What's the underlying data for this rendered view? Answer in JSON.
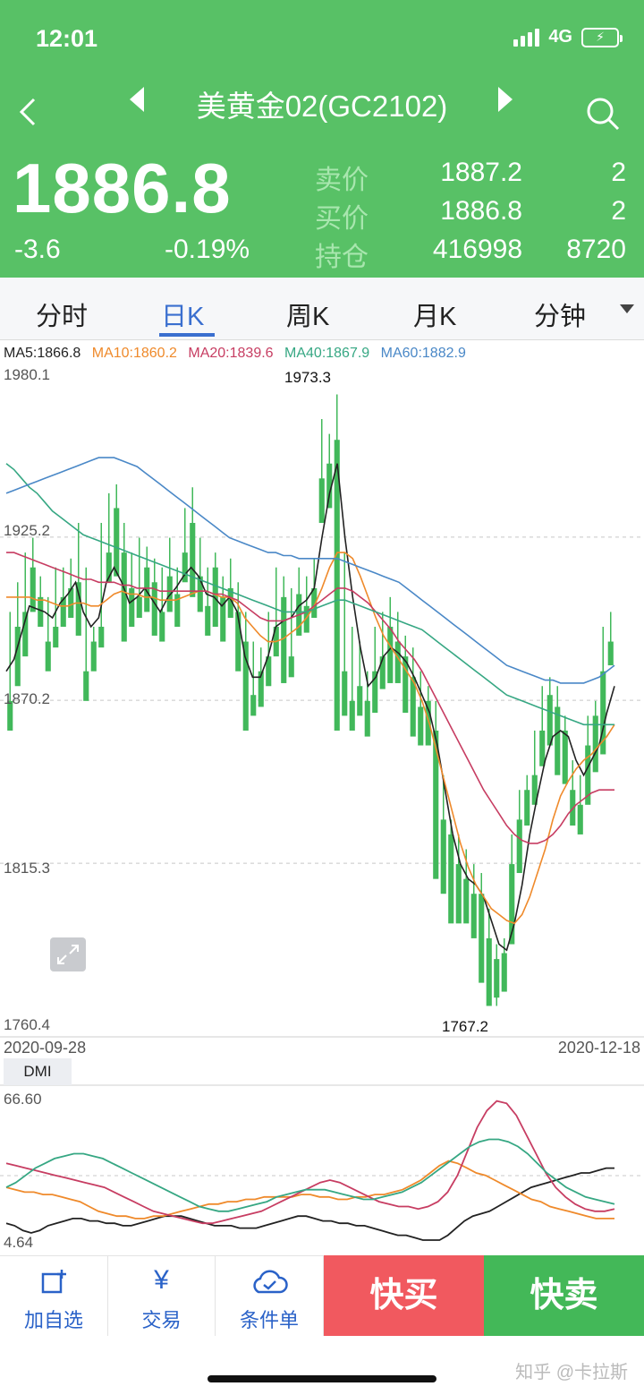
{
  "status": {
    "time": "12:01",
    "network": "4G"
  },
  "header": {
    "title": "美黄金02(GC2102)"
  },
  "quote": {
    "last": "1886.8",
    "change": "-3.6",
    "change_pct": "-0.19%",
    "ask_label": "卖价",
    "ask": "1887.2",
    "ask_vol": "2",
    "bid_label": "买价",
    "bid": "1886.8",
    "bid_vol": "2",
    "oi_label": "持仓",
    "oi": "416998",
    "oi_chg": "8720"
  },
  "tabs": [
    "分时",
    "日K",
    "周K",
    "月K",
    "分钟"
  ],
  "active_tab": "日K",
  "ma": {
    "ma5": "MA5:1866.8",
    "ma10": "MA10:1860.2",
    "ma20": "MA20:1839.6",
    "ma40": "MA40:1867.9",
    "ma60": "MA60:1882.9"
  },
  "colors": {
    "header_green": "#58c166",
    "up": "#ef5a5f",
    "down": "#41b85a",
    "ma5": "#222222",
    "ma10": "#ef8a2b",
    "ma20": "#c73d62",
    "ma40": "#36a783",
    "ma60": "#4a88c7",
    "active_tab": "#3a6fcf"
  },
  "chart_data": [
    {
      "type": "candlestick",
      "y_ticks": [
        "1980.1",
        "1925.2",
        "1870.2",
        "1815.3",
        "1760.4"
      ],
      "ylim": [
        1760.4,
        1980.1
      ],
      "x_start": "2020-09-28",
      "x_end": "2020-12-18",
      "annotations": {
        "high": "1973.3",
        "low": "1767.2"
      },
      "candles": [
        [
          1870,
          1900,
          1865,
          1860
        ],
        [
          1895,
          1910,
          1880,
          1875
        ],
        [
          1900,
          1920,
          1890,
          1885
        ],
        [
          1915,
          1925,
          1905,
          1900
        ],
        [
          1905,
          1912,
          1898,
          1895
        ],
        [
          1890,
          1905,
          1884,
          1880
        ],
        [
          1895,
          1915,
          1890,
          1888
        ],
        [
          1905,
          1915,
          1898,
          1895
        ],
        [
          1908,
          1918,
          1900,
          1898
        ],
        [
          1910,
          1930,
          1895,
          1892
        ],
        [
          1880,
          1915,
          1875,
          1870
        ],
        [
          1890,
          1895,
          1883,
          1880
        ],
        [
          1895,
          1930,
          1890,
          1888
        ],
        [
          1920,
          1940,
          1915,
          1910
        ],
        [
          1935,
          1943,
          1915,
          1912
        ],
        [
          1920,
          1930,
          1895,
          1890
        ],
        [
          1908,
          1920,
          1902,
          1895
        ],
        [
          1905,
          1925,
          1900,
          1898
        ],
        [
          1915,
          1922,
          1905,
          1900
        ],
        [
          1910,
          1918,
          1895,
          1892
        ],
        [
          1900,
          1915,
          1895,
          1890
        ],
        [
          1912,
          1925,
          1905,
          1900
        ],
        [
          1906,
          1915,
          1900,
          1895
        ],
        [
          1920,
          1935,
          1915,
          1910
        ],
        [
          1930,
          1942,
          1908,
          1905
        ],
        [
          1912,
          1925,
          1905,
          1900
        ],
        [
          1902,
          1915,
          1895,
          1892
        ],
        [
          1915,
          1920,
          1898,
          1895
        ],
        [
          1905,
          1912,
          1895,
          1890
        ],
        [
          1908,
          1918,
          1902,
          1898
        ],
        [
          1900,
          1910,
          1885,
          1880
        ],
        [
          1890,
          1900,
          1865,
          1860
        ],
        [
          1872,
          1890,
          1868,
          1865
        ],
        [
          1880,
          1888,
          1870,
          1868
        ],
        [
          1885,
          1900,
          1878,
          1875
        ],
        [
          1895,
          1915,
          1888,
          1885
        ],
        [
          1905,
          1912,
          1880,
          1876
        ],
        [
          1885,
          1908,
          1880,
          1878
        ],
        [
          1906,
          1915,
          1895,
          1892
        ],
        [
          1902,
          1912,
          1895,
          1893
        ],
        [
          1908,
          1918,
          1900,
          1898
        ],
        [
          1945,
          1965,
          1935,
          1930
        ],
        [
          1950,
          1960,
          1940,
          1935
        ],
        [
          1958,
          1973.3,
          1875,
          1860
        ],
        [
          1880,
          1920,
          1870,
          1865
        ],
        [
          1870,
          1895,
          1865,
          1860
        ],
        [
          1875,
          1890,
          1868,
          1865
        ],
        [
          1870,
          1880,
          1862,
          1858
        ],
        [
          1880,
          1895,
          1870,
          1866
        ],
        [
          1885,
          1900,
          1878,
          1874
        ],
        [
          1895,
          1905,
          1880,
          1876
        ],
        [
          1890,
          1900,
          1880,
          1876
        ],
        [
          1885,
          1892,
          1870,
          1866
        ],
        [
          1878,
          1888,
          1862,
          1858
        ],
        [
          1868,
          1880,
          1860,
          1855
        ],
        [
          1870,
          1875,
          1860,
          1855
        ],
        [
          1860,
          1870,
          1815,
          1810
        ],
        [
          1830,
          1845,
          1810,
          1805
        ],
        [
          1825,
          1830,
          1800,
          1795
        ],
        [
          1815,
          1825,
          1800,
          1795
        ],
        [
          1810,
          1820,
          1800,
          1795
        ],
        [
          1805,
          1815,
          1795,
          1790
        ],
        [
          1805,
          1812,
          1780,
          1775
        ],
        [
          1790,
          1800,
          1770,
          1767.2
        ],
        [
          1783,
          1788,
          1767.2,
          1770
        ],
        [
          1785,
          1790,
          1775,
          1772
        ],
        [
          1815,
          1825,
          1790,
          1788
        ],
        [
          1830,
          1840,
          1815,
          1812
        ],
        [
          1840,
          1845,
          1830,
          1828
        ],
        [
          1845,
          1860,
          1838,
          1835
        ],
        [
          1860,
          1875,
          1850,
          1848
        ],
        [
          1872,
          1878,
          1860,
          1855
        ],
        [
          1868,
          1875,
          1850,
          1845
        ],
        [
          1860,
          1865,
          1845,
          1842
        ],
        [
          1840,
          1850,
          1830,
          1828
        ],
        [
          1835,
          1845,
          1830,
          1825
        ],
        [
          1855,
          1865,
          1838,
          1835
        ],
        [
          1865,
          1870,
          1850,
          1846
        ],
        [
          1880,
          1895,
          1855,
          1852
        ],
        [
          1890,
          1900,
          1886,
          1882
        ]
      ],
      "ma_series": {
        "MA5": [
          1880,
          1884,
          1893,
          1902,
          1901,
          1900,
          1898,
          1903,
          1906,
          1910,
          1900,
          1895,
          1898,
          1910,
          1915,
          1910,
          1903,
          1905,
          1908,
          1904,
          1900,
          1905,
          1908,
          1912,
          1915,
          1912,
          1906,
          1905,
          1902,
          1905,
          1900,
          1885,
          1878,
          1878,
          1885,
          1895,
          1897,
          1898,
          1902,
          1904,
          1908,
          1925,
          1940,
          1950,
          1925,
          1905,
          1888,
          1875,
          1878,
          1885,
          1888,
          1886,
          1883,
          1878,
          1872,
          1866,
          1855,
          1840,
          1825,
          1815,
          1810,
          1808,
          1804,
          1796,
          1788,
          1786,
          1795,
          1808,
          1825,
          1838,
          1850,
          1858,
          1860,
          1858,
          1850,
          1845,
          1850,
          1855,
          1866,
          1875
        ],
        "MA10": [
          1905,
          1905,
          1905,
          1905,
          1904,
          1904,
          1903,
          1902,
          1902,
          1903,
          1903,
          1902,
          1902,
          1904,
          1906,
          1907,
          1906,
          1906,
          1905,
          1905,
          1904,
          1904,
          1904,
          1905,
          1906,
          1907,
          1907,
          1906,
          1905,
          1905,
          1903,
          1898,
          1895,
          1892,
          1890,
          1890,
          1891,
          1893,
          1895,
          1898,
          1902,
          1908,
          1915,
          1920,
          1920,
          1918,
          1912,
          1905,
          1898,
          1892,
          1888,
          1884,
          1880,
          1876,
          1870,
          1862,
          1852,
          1842,
          1832,
          1822,
          1814,
          1808,
          1804,
          1800,
          1798,
          1796,
          1795,
          1798,
          1804,
          1812,
          1820,
          1830,
          1838,
          1843,
          1847,
          1850,
          1852,
          1855,
          1858,
          1862
        ],
        "MA20": [
          1920,
          1920,
          1919,
          1918,
          1917,
          1916,
          1915,
          1914,
          1913,
          1912,
          1911,
          1911,
          1910,
          1910,
          1910,
          1909,
          1909,
          1908,
          1908,
          1908,
          1907,
          1907,
          1907,
          1907,
          1907,
          1907,
          1907,
          1906,
          1906,
          1905,
          1904,
          1902,
          1900,
          1898,
          1897,
          1897,
          1897,
          1898,
          1899,
          1900,
          1902,
          1904,
          1906,
          1908,
          1908,
          1907,
          1905,
          1903,
          1900,
          1897,
          1894,
          1890,
          1887,
          1884,
          1880,
          1875,
          1870,
          1865,
          1860,
          1855,
          1850,
          1845,
          1840,
          1836,
          1832,
          1828,
          1825,
          1823,
          1822,
          1822,
          1823,
          1825,
          1828,
          1832,
          1835,
          1837,
          1839,
          1840,
          1840,
          1840
        ],
        "MA40": [
          1950,
          1948,
          1945,
          1942,
          1940,
          1937,
          1934,
          1932,
          1930,
          1928,
          1926,
          1925,
          1924,
          1923,
          1922,
          1921,
          1920,
          1919,
          1918,
          1917,
          1916,
          1915,
          1914,
          1913,
          1912,
          1911,
          1910,
          1909,
          1908,
          1907,
          1906,
          1905,
          1904,
          1903,
          1902,
          1901,
          1900,
          1900,
          1900,
          1900,
          1901,
          1902,
          1903,
          1904,
          1904,
          1903,
          1902,
          1901,
          1900,
          1899,
          1898,
          1897,
          1896,
          1895,
          1894,
          1892,
          1890,
          1888,
          1886,
          1884,
          1882,
          1880,
          1878,
          1876,
          1874,
          1872,
          1871,
          1870,
          1869,
          1868,
          1867,
          1866,
          1865,
          1864,
          1863,
          1862,
          1862,
          1862,
          1862,
          1862
        ],
        "MA60": [
          1940,
          1941,
          1942,
          1943,
          1944,
          1945,
          1946,
          1947,
          1948,
          1949,
          1950,
          1951,
          1952,
          1952,
          1952,
          1951,
          1950,
          1949,
          1947,
          1945,
          1943,
          1941,
          1939,
          1937,
          1935,
          1933,
          1931,
          1929,
          1927,
          1925,
          1924,
          1923,
          1922,
          1921,
          1920,
          1920,
          1919,
          1919,
          1918,
          1918,
          1918,
          1918,
          1918,
          1918,
          1917,
          1916,
          1915,
          1914,
          1913,
          1912,
          1911,
          1910,
          1908,
          1906,
          1904,
          1902,
          1900,
          1898,
          1896,
          1894,
          1892,
          1890,
          1888,
          1886,
          1884,
          1882,
          1881,
          1880,
          1879,
          1878,
          1877,
          1877,
          1876,
          1876,
          1876,
          1876,
          1877,
          1878,
          1880,
          1882
        ]
      }
    },
    {
      "type": "line",
      "title": "DMI",
      "y_ticks": [
        "66.60",
        "4.64"
      ],
      "ylim": [
        4.64,
        66.6
      ],
      "series": [
        {
          "color": "#222222",
          "values": [
            15,
            14,
            12,
            11,
            12,
            14,
            15,
            16,
            17,
            17,
            16,
            16,
            15,
            15,
            14,
            14,
            15,
            16,
            17,
            18,
            18,
            18,
            17,
            16,
            15,
            14,
            14,
            14,
            13,
            13,
            13,
            14,
            15,
            16,
            17,
            18,
            18,
            17,
            16,
            16,
            15,
            15,
            14,
            14,
            13,
            12,
            11,
            10,
            10,
            9,
            8,
            8,
            8,
            10,
            13,
            16,
            18,
            19,
            20,
            22,
            24,
            26,
            28,
            30,
            31,
            32,
            33,
            34,
            35,
            36,
            36,
            37,
            38,
            38
          ]
        },
        {
          "color": "#ef8a2b",
          "values": [
            30,
            29,
            28,
            28,
            27,
            27,
            26,
            25,
            24,
            22,
            20,
            19,
            18,
            18,
            17,
            17,
            18,
            18,
            19,
            20,
            21,
            22,
            23,
            23,
            24,
            24,
            25,
            25,
            26,
            26,
            26,
            26,
            27,
            27,
            26,
            26,
            25,
            25,
            26,
            26,
            27,
            27,
            28,
            29,
            31,
            33,
            36,
            39,
            41,
            40,
            38,
            36,
            35,
            33,
            31,
            29,
            27,
            25,
            24,
            22,
            21,
            20,
            19,
            18,
            17,
            17,
            17
          ]
        },
        {
          "color": "#c73d62",
          "values": [
            40,
            39,
            38,
            37,
            36,
            35,
            34,
            33,
            32,
            31,
            30,
            28,
            26,
            24,
            22,
            20,
            19,
            18,
            17,
            16,
            15,
            15,
            16,
            17,
            18,
            19,
            20,
            22,
            24,
            26,
            28,
            30,
            32,
            33,
            32,
            30,
            28,
            26,
            24,
            23,
            22,
            22,
            21,
            22,
            24,
            28,
            35,
            45,
            55,
            62,
            66,
            65,
            60,
            52,
            44,
            36,
            30,
            26,
            23,
            21,
            20,
            20,
            21
          ]
        },
        {
          "color": "#36a783",
          "values": [
            30,
            32,
            35,
            38,
            40,
            42,
            43,
            44,
            44,
            43,
            42,
            40,
            38,
            36,
            34,
            32,
            30,
            28,
            26,
            24,
            22,
            21,
            20,
            20,
            21,
            22,
            23,
            24,
            26,
            27,
            28,
            29,
            29,
            29,
            28,
            27,
            26,
            25,
            25,
            26,
            27,
            28,
            30,
            32,
            35,
            38,
            41,
            44,
            47,
            49,
            50,
            50,
            49,
            47,
            44,
            40,
            36,
            33,
            30,
            28,
            26,
            25,
            24,
            23
          ]
        }
      ]
    }
  ],
  "chart_ui": {
    "dmi_tab": "DMI"
  },
  "bottom": {
    "watch_label": "加自选",
    "trade_label": "交易",
    "trade_icon": "¥",
    "cond_label": "条件单",
    "buy_label": "快买",
    "sell_label": "快卖"
  },
  "watermark": "知乎 @卡拉斯"
}
